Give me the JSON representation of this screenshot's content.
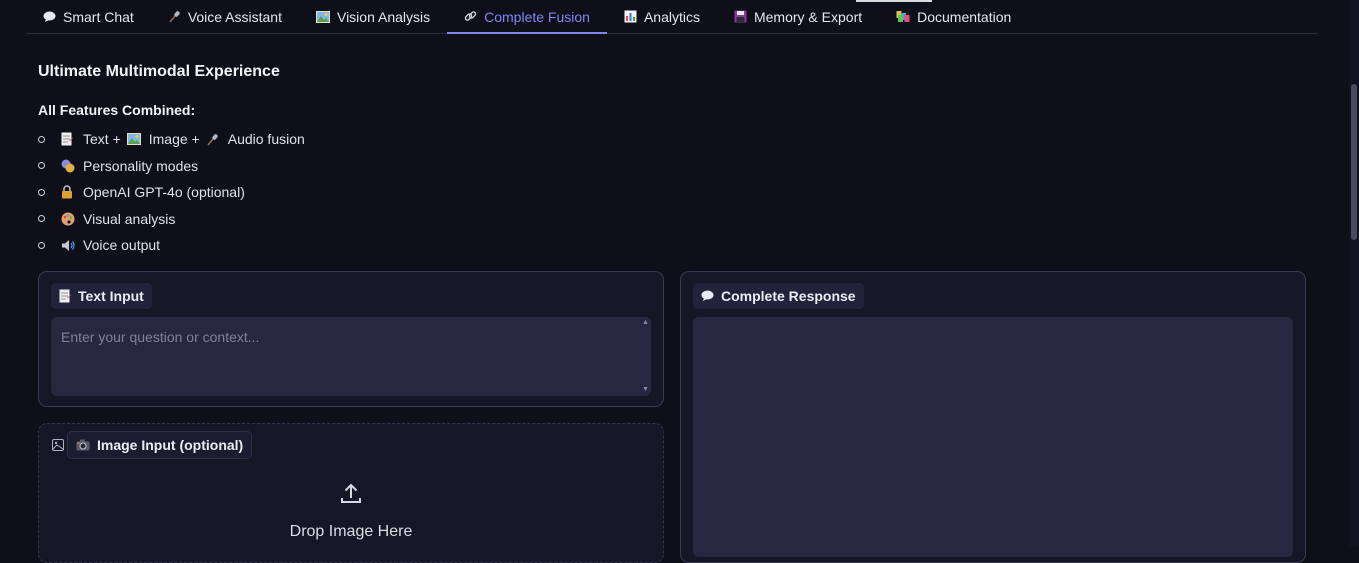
{
  "tabs": [
    {
      "icon": "speech-bubble-icon",
      "label": "Smart Chat",
      "active": false
    },
    {
      "icon": "microphone-icon",
      "label": "Voice Assistant",
      "active": false
    },
    {
      "icon": "picture-icon",
      "label": "Vision Analysis",
      "active": false
    },
    {
      "icon": "link-icon",
      "label": "Complete Fusion",
      "active": true
    },
    {
      "icon": "bar-chart-icon",
      "label": "Analytics",
      "active": false
    },
    {
      "icon": "floppy-disk-icon",
      "label": "Memory & Export",
      "active": false
    },
    {
      "icon": "books-icon",
      "label": "Documentation",
      "active": false
    }
  ],
  "main": {
    "heading": "Ultimate Multimodal Experience",
    "features_title": "All Features Combined:",
    "features": [
      {
        "parts": [
          "Text + ",
          "Image + ",
          "Audio fusion"
        ]
      },
      {
        "text": "Personality modes"
      },
      {
        "text": "OpenAI GPT-4o (optional)"
      },
      {
        "text": "Visual analysis"
      },
      {
        "text": "Voice output"
      }
    ]
  },
  "text_input": {
    "label": "Text Input",
    "placeholder": "Enter your question or context...",
    "value": ""
  },
  "image_input": {
    "label": "Image Input (optional)",
    "drop_text": "Drop Image Here"
  },
  "response": {
    "label": "Complete Response",
    "value": ""
  },
  "colors": {
    "background": "#0f0f1a",
    "accent": "#7f86f2",
    "panel": "#161626",
    "field": "#27273f"
  }
}
